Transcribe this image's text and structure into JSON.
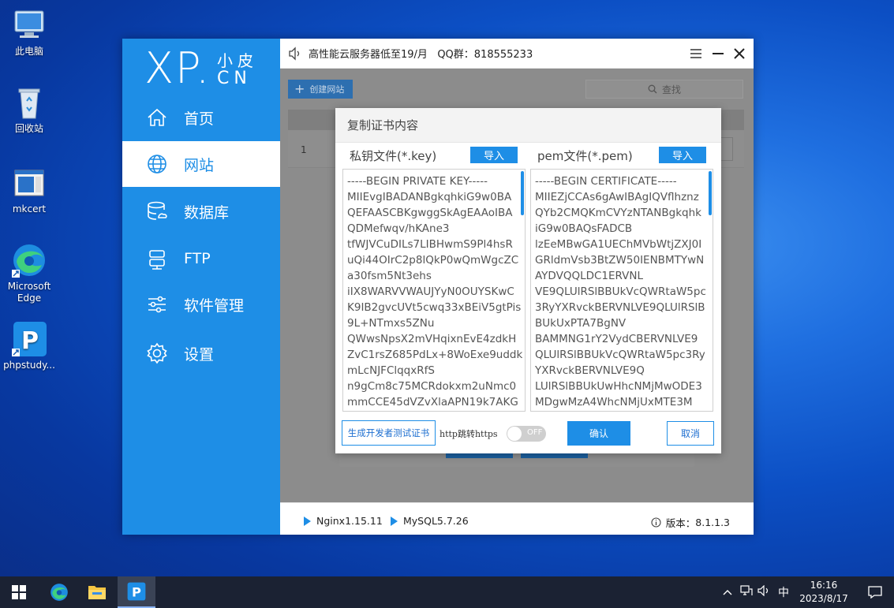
{
  "desktop": {
    "icons": [
      {
        "label": "此电脑",
        "icon": "computer-icon"
      },
      {
        "label": "回收站",
        "icon": "recycle-bin-icon"
      },
      {
        "label": "mkcert",
        "icon": "window-file-icon"
      },
      {
        "label": "Microsoft Edge",
        "icon": "edge-icon"
      },
      {
        "label": "phpstudy...",
        "icon": "phpstudy-icon"
      }
    ]
  },
  "app": {
    "logo": {
      "main": "XP.",
      "cn_top": "小皮",
      "cn_bottom": "CN"
    },
    "nav": [
      {
        "label": "首页",
        "icon": "home-icon"
      },
      {
        "label": "网站",
        "icon": "globe-icon",
        "active": true
      },
      {
        "label": "数据库",
        "icon": "database-icon"
      },
      {
        "label": "FTP",
        "icon": "server-icon"
      },
      {
        "label": "软件管理",
        "icon": "sliders-icon"
      },
      {
        "label": "设置",
        "icon": "gear-icon"
      }
    ],
    "notice": "高性能云服务器低至19/月   QQ群：818555233",
    "toolbar": {
      "create_label": "创建网站",
      "search_label": "查找"
    },
    "table": {
      "rows": [
        {
          "num": "1"
        }
      ]
    },
    "status": {
      "services": [
        "Nginx1.15.11",
        "MySQL5.7.26"
      ],
      "version_label": "版本：",
      "version": "8.1.1.3"
    }
  },
  "dialog": {
    "title": "复制证书内容",
    "key_label": "私钥文件(*.key)",
    "pem_label": "pem文件(*.pem)",
    "import_label": "导入",
    "key_text": "-----BEGIN PRIVATE KEY-----\nMIIEvgIBADANBgkqhkiG9w0BA\nQEFAASCBKgwggSkAgEAAoIBA\nQDMefwqv/hKAne3\ntfWJVCuDILs7LIBHwmS9Pl4hsR\nuQi44OIrC2p8lQkP0wQmWgcZC\na30fsm5Nt3ehs\niIX8WARVVWAUJYyN0OUYSKwC\nK9IB2gvcUVt5cwq33xBEiV5gtPis\n9L+NTmxs5ZNu\nQWwsNpsX2mVHqixnEvE4zdkH\nZvC1rsZ685PdLx+8WoExe9uddk\nmLcNJFClqqxRfS\nn9gCm8c75MCRdokxm2uNmc0\nmmCCE45dVZvXlaAPN19k7AKG",
    "pem_text": "-----BEGIN CERTIFICATE-----\nMIIEZjCCAs6gAwIBAgIQVflhznz\nQYb2CMQKmCVYzNTANBgkqhk\niG9w0BAQsFADCB\nlzEeMBwGA1UEChMVbWtjZXJ0I\nGRldmVsb3BtZW50IENBMTYwN\nAYDVQQLDC1ERVNL\nVE9QLUlRSlBBUkVcQWRtaW5pc\n3RyYXRvckBERVNLVE9QLUlRSlB\nBUkUxPTA7BgNV\nBAMMNG1rY2VydCBERVNLVE9\nQLUlRSlBBUkVcQWRtaW5pc3Ry\nYXRvckBERVNLVE9Q\nLUlRSlBBUkUwHhcNMjMwODE3\nMDgwMzA4WhcNMjUxMTE3M",
    "gen_label": "生成开发者测试证书",
    "redirect_label": "http跳转https",
    "toggle_label": "OFF",
    "ok_label": "确认",
    "cancel_label": "取消"
  },
  "taskbar": {
    "apps": [
      {
        "icon": "windows-start-icon"
      },
      {
        "icon": "edge-icon"
      },
      {
        "icon": "file-explorer-icon"
      },
      {
        "icon": "phpstudy-icon",
        "active": true
      }
    ],
    "ime": "中",
    "time": "16:16",
    "date": "2023/8/17"
  }
}
